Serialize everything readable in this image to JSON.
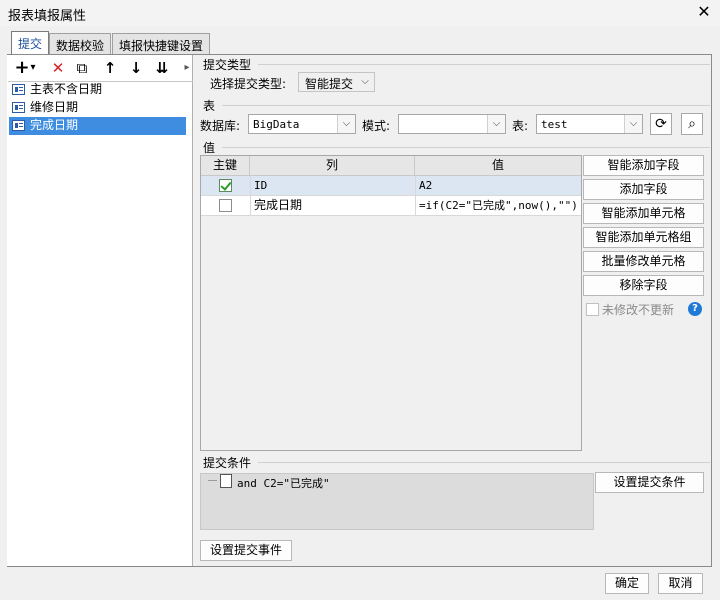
{
  "window": {
    "title": "报表填报属性",
    "close_symbol": "✕"
  },
  "tabs": [
    {
      "label": "提交"
    },
    {
      "label": "数据校验"
    },
    {
      "label": "填报快捷键设置"
    }
  ],
  "left": {
    "toolbar": {
      "add": "+",
      "add_dropdown": "▾",
      "delete": "✕",
      "copy": "⧉",
      "up": "↑",
      "down": "↓",
      "sort": "⇊",
      "collapse": "▸"
    },
    "items": [
      {
        "label": "主表不含日期"
      },
      {
        "label": "维修日期"
      },
      {
        "label": "完成日期"
      }
    ]
  },
  "submit_type": {
    "section": "提交类型",
    "label": "选择提交类型:",
    "value": "智能提交"
  },
  "table": {
    "section": "表",
    "db_label": "数据库:",
    "db_value": "BigData",
    "mode_label": "模式:",
    "mode_value": "",
    "table_label": "表:",
    "table_value": "test"
  },
  "values": {
    "section": "值",
    "headers": {
      "key": "主键",
      "col": "列",
      "val": "值"
    },
    "rows": [
      {
        "key": true,
        "col": "ID",
        "val": "A2"
      },
      {
        "key": false,
        "col": "完成日期",
        "val": "=if(C2=\"已完成\",now(),\"\")"
      }
    ],
    "buttons": {
      "smart_add_field": "智能添加字段",
      "add_field": "添加字段",
      "smart_add_cell": "智能添加单元格",
      "smart_add_cell_group": "智能添加单元格组",
      "batch_modify_cell": "批量修改单元格",
      "remove_field": "移除字段"
    },
    "no_update_label": "未修改不更新",
    "help": "?"
  },
  "condition": {
    "section": "提交条件",
    "text": "and C2=\"已完成\"",
    "set_button": "设置提交条件"
  },
  "event_button": "设置提交事件",
  "footer": {
    "ok": "确定",
    "cancel": "取消"
  },
  "colors": {
    "selection": "#3e8de0",
    "row_selected": "#dce6f2",
    "accent_text": "#1a4e9a"
  }
}
